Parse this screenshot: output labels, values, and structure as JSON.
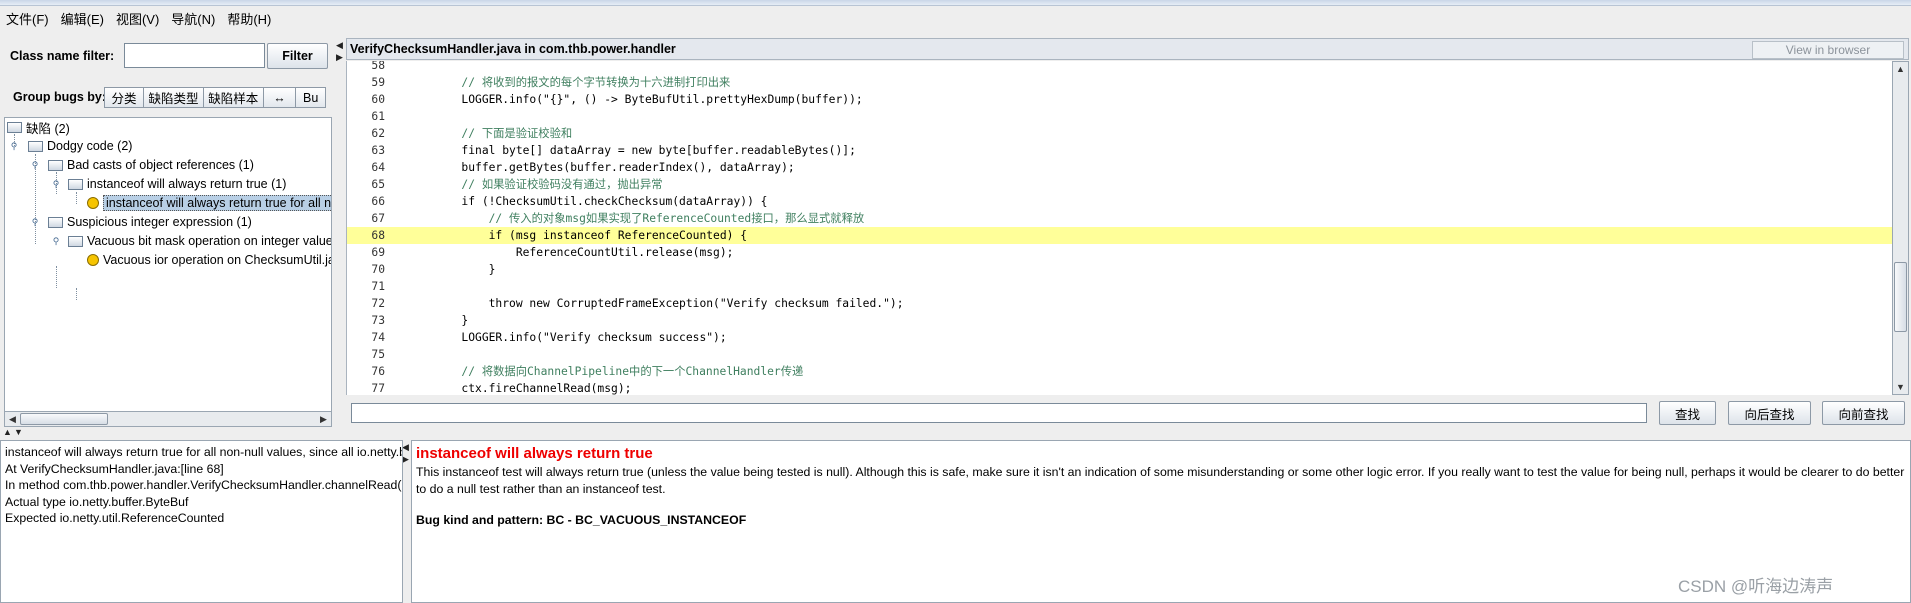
{
  "menu": [
    "文件(F)",
    "编辑(E)",
    "视图(V)",
    "导航(N)",
    "帮助(H)"
  ],
  "filter": {
    "label": "Class name filter:",
    "value": "",
    "button": "Filter"
  },
  "group": {
    "label": "Group bugs by:",
    "buttons": [
      "分类",
      "缺陷类型",
      "缺陷样本",
      "↔",
      "Bu"
    ]
  },
  "tree": {
    "root": "缺陷 (2)",
    "n1": "Dodgy code (2)",
    "n2": "Bad casts of object references (1)",
    "n3": "instanceof will always return true (1)",
    "n4": "instanceof will always return true for all no",
    "n5": "Suspicious integer expression (1)",
    "n6": "Vacuous bit mask operation on integer value (",
    "n7": "Vacuous ior operation on ChecksumUtil.ja"
  },
  "code": {
    "title": "VerifyChecksumHandler.java in com.thb.power.handler",
    "view_in_browser": "View in browser",
    "lines": [
      {
        "n": "58",
        "t": ""
      },
      {
        "n": "59",
        "t": "        // 将收到的报文的每个字节转换为十六进制打印出来"
      },
      {
        "n": "60",
        "t": "        LOGGER.info(\"{}\", () -> ByteBufUtil.prettyHexDump(buffer));"
      },
      {
        "n": "61",
        "t": ""
      },
      {
        "n": "62",
        "t": "        // 下面是验证校验和"
      },
      {
        "n": "63",
        "t": "        final byte[] dataArray = new byte[buffer.readableBytes()];"
      },
      {
        "n": "64",
        "t": "        buffer.getBytes(buffer.readerIndex(), dataArray);"
      },
      {
        "n": "65",
        "t": "        // 如果验证校验码没有通过，抛出异常"
      },
      {
        "n": "66",
        "t": "        if (!ChecksumUtil.checkChecksum(dataArray)) {"
      },
      {
        "n": "67",
        "t": "            // 传入的对象msg如果实现了ReferenceCounted接口，那么显式就释放"
      },
      {
        "n": "68",
        "t": "            if (msg instanceof ReferenceCounted) {"
      },
      {
        "n": "69",
        "t": "                ReferenceCountUtil.release(msg);"
      },
      {
        "n": "70",
        "t": "            }"
      },
      {
        "n": "71",
        "t": ""
      },
      {
        "n": "72",
        "t": "            throw new CorruptedFrameException(\"Verify checksum failed.\");"
      },
      {
        "n": "73",
        "t": "        }"
      },
      {
        "n": "74",
        "t": "        LOGGER.info(\"Verify checksum success\");"
      },
      {
        "n": "75",
        "t": ""
      },
      {
        "n": "76",
        "t": "        // 将数据向ChannelPipeline中的下一个ChannelHandler传递"
      },
      {
        "n": "77",
        "t": "        ctx.fireChannelRead(msg);"
      }
    ],
    "highlight_line": "68"
  },
  "search": {
    "value": "",
    "find": "查找",
    "find_next": "向后查找",
    "find_prev": "向前查找"
  },
  "summary": [
    "instanceof will always return true for all non-null values, since all io.netty.buffer.ByteBuf are instances of io.netty.util.ReferenceCounted",
    "At VerifyChecksumHandler.java:[line 68]",
    "In method com.thb.power.handler.VerifyChecksumHandler.channelRead(ChannelHandlerContext, Object)",
    "Actual type io.netty.buffer.ByteBuf",
    "Expected io.netty.util.ReferenceCounted"
  ],
  "detail": {
    "title": "instanceof will always return true",
    "desc": "This instanceof test will always return true (unless the value being tested is null). Although this is safe, make sure it isn't an indication of some misunderstanding or some other logic error. If you really want to test the value for being null, perhaps it would be clearer to do better to do a null test rather than an instanceof test.",
    "pattern": "Bug kind and pattern: BC - BC_VACUOUS_INSTANCEOF"
  },
  "watermark": "CSDN @听海边涛声"
}
